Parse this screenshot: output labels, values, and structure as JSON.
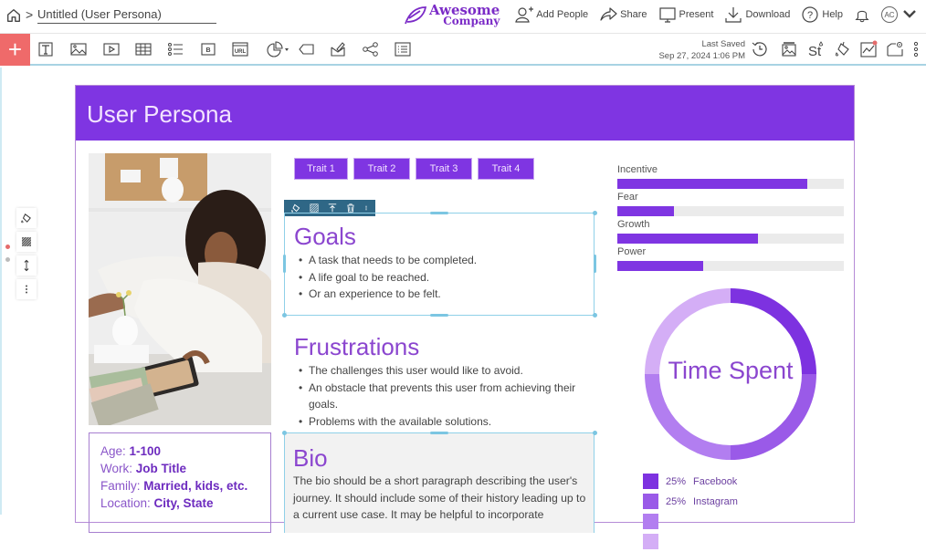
{
  "header": {
    "breadcrumb_sep": ">",
    "doc_title": "Untitled (User Persona)",
    "brand_line1": "Awesome",
    "brand_line2": "Company",
    "actions": [
      {
        "label": "Add People",
        "icon": "add-person-icon"
      },
      {
        "label": "Share",
        "icon": "share-icon"
      },
      {
        "label": "Present",
        "icon": "present-icon"
      },
      {
        "label": "Download",
        "icon": "download-icon"
      },
      {
        "label": "Help",
        "icon": "help-icon"
      }
    ],
    "avatar_initials": "AC"
  },
  "toolbar": {
    "add_symbol": "+",
    "tools": [
      "text-icon",
      "image-icon",
      "video-icon",
      "table-icon",
      "list-icon",
      "button-icon",
      "url-icon",
      "chart-icon",
      "shape-icon",
      "interactive-icon",
      "network-icon",
      "content-list-icon"
    ],
    "last_saved_label": "Last Saved",
    "last_saved_time": "Sep 27, 2024 1:06 PM",
    "right_tools": [
      "history-icon",
      "background-image-icon",
      "text-style-icon",
      "color-fill-icon",
      "analytics-icon",
      "settings-folder-icon",
      "more-icon"
    ]
  },
  "page": {
    "title": "User Persona",
    "traits": [
      "Trait 1",
      "Trait 2",
      "Trait 3",
      "Trait 4"
    ],
    "goals": {
      "heading": "Goals",
      "items": [
        "A task that needs to be completed.",
        "A life goal to be reached.",
        "Or an experience to be felt."
      ]
    },
    "frustrations": {
      "heading": "Frustrations",
      "items": [
        "The challenges this user would like to avoid.",
        "An obstacle that prevents this user from achieving their goals.",
        "Problems with the available solutions."
      ]
    },
    "bio": {
      "heading": "Bio",
      "text": "The bio should be a short paragraph describing the user's journey. It should include some of their history leading up to a current use case. It may be helpful to incorporate"
    },
    "info": [
      {
        "label": "Age: ",
        "value": "1-100"
      },
      {
        "label": "Work: ",
        "value": "Job Title"
      },
      {
        "label": "Family: ",
        "value": "Married, kids, etc."
      },
      {
        "label": "Location: ",
        "value": "City, State"
      }
    ],
    "motivations": [
      {
        "label": "Incentive",
        "value": 0.84
      },
      {
        "label": "Fear",
        "value": 0.25
      },
      {
        "label": "Growth",
        "value": 0.62
      },
      {
        "label": "Power",
        "value": 0.38
      }
    ],
    "time_spent": {
      "title": "Time Spent",
      "segments": [
        {
          "pct": 25,
          "label": "Facebook",
          "color": "#7d32e0"
        },
        {
          "pct": 25,
          "label": "Instagram",
          "color": "#9a5ae8"
        },
        {
          "pct": 25,
          "label": "",
          "color": "#b27ef0"
        },
        {
          "pct": 25,
          "label": "",
          "color": "#d4aef6"
        }
      ]
    }
  },
  "colors": {
    "brand_purple": "#7f35e2",
    "add_button": "#ef6a6a",
    "selection": "#8fd0e8"
  }
}
